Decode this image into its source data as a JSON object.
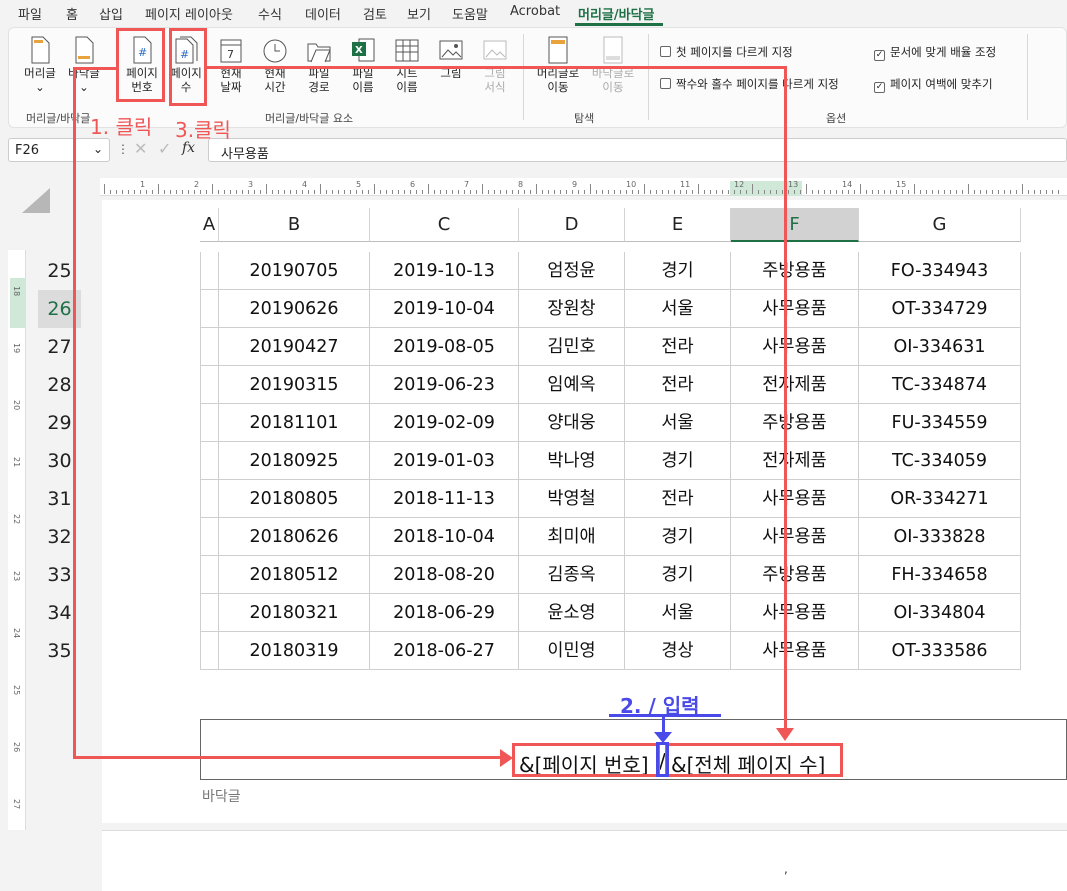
{
  "menubar": {
    "items": [
      "파일",
      "홈",
      "삽입",
      "페이지 레이아웃",
      "수식",
      "데이터",
      "검토",
      "보기",
      "도움말",
      "Acrobat",
      "머리글/바닥글"
    ]
  },
  "ribbon": {
    "buttons": {
      "header": "머리글",
      "footer": "바닥글",
      "page_number": "페이지\n번호",
      "page_count": "페이지\n수",
      "current_date": "현재\n날짜",
      "current_time": "현재\n시간",
      "file_path": "파일\n경로",
      "file_name": "파일\n이름",
      "sheet_name": "시트\n이름",
      "picture": "그림",
      "format_picture": "그림\n서식",
      "go_to_header": "머리글로\n이동",
      "go_to_footer": "바닥글로\n이동"
    },
    "groups": {
      "header_footer": "머리글/바닥글",
      "elements": "머리글/바닥글 요소",
      "navigation": "탐색",
      "options": "옵션"
    },
    "options": [
      {
        "label": "첫 페이지를 다르게 지정",
        "checked": false
      },
      {
        "label": "짝수와 홀수 페이지를 다르게 지정",
        "checked": false
      },
      {
        "label": "문서에 맞게 배율 조정",
        "checked": true
      },
      {
        "label": "페이지 여백에 맞추기",
        "checked": true
      }
    ]
  },
  "formula_bar": {
    "name_box": "F26",
    "fx": "fx",
    "value": "사무용품"
  },
  "columns": [
    "A",
    "B",
    "C",
    "D",
    "E",
    "F",
    "G"
  ],
  "rows": [
    {
      "num": "25",
      "cells": [
        "20190705",
        "2019-10-13",
        "엄정윤",
        "경기",
        "주방용품",
        "FO-334943"
      ]
    },
    {
      "num": "26",
      "cells": [
        "20190626",
        "2019-10-04",
        "장원창",
        "서울",
        "사무용품",
        "OT-334729"
      ]
    },
    {
      "num": "27",
      "cells": [
        "20190427",
        "2019-08-05",
        "김민호",
        "전라",
        "사무용품",
        "OI-334631"
      ]
    },
    {
      "num": "28",
      "cells": [
        "20190315",
        "2019-06-23",
        "임예옥",
        "전라",
        "전자제품",
        "TC-334874"
      ]
    },
    {
      "num": "29",
      "cells": [
        "20181101",
        "2019-02-09",
        "양대웅",
        "서울",
        "주방용품",
        "FU-334559"
      ]
    },
    {
      "num": "30",
      "cells": [
        "20180925",
        "2019-01-03",
        "박나영",
        "경기",
        "전자제품",
        "TC-334059"
      ]
    },
    {
      "num": "31",
      "cells": [
        "20180805",
        "2018-11-13",
        "박영철",
        "전라",
        "사무용품",
        "OR-334271"
      ]
    },
    {
      "num": "32",
      "cells": [
        "20180626",
        "2018-10-04",
        "최미애",
        "경기",
        "사무용품",
        "OI-333828"
      ]
    },
    {
      "num": "33",
      "cells": [
        "20180512",
        "2018-08-20",
        "김종옥",
        "경기",
        "주방용품",
        "FH-334658"
      ]
    },
    {
      "num": "34",
      "cells": [
        "20180321",
        "2018-06-29",
        "윤소영",
        "서울",
        "사무용품",
        "OI-334804"
      ]
    },
    {
      "num": "35",
      "cells": [
        "20180319",
        "2018-06-27",
        "이민영",
        "경상",
        "사무용품",
        "OT-333586"
      ]
    }
  ],
  "footer": {
    "label": "바닥글",
    "page_number_code": "&[페이지 번호]",
    "separator": "/",
    "page_count_code": "&[전체 페이지 수]"
  },
  "annotations": {
    "step1": "1. 클릭",
    "step2": "2. / 입력",
    "step3": "3.클릭"
  },
  "ruler": {
    "h_ticks": [
      "1",
      "2",
      "3",
      "4",
      "5",
      "6",
      "7",
      "8",
      "9",
      "10",
      "11",
      "12",
      "13",
      "14",
      "15"
    ],
    "v_ticks": [
      "18",
      "19",
      "20",
      "21",
      "22",
      "23",
      "24",
      "25",
      "26",
      "27"
    ]
  },
  "colors": {
    "accent": "#1e7145",
    "annotation_red": "#f05656",
    "annotation_blue": "#4a4ae8"
  }
}
